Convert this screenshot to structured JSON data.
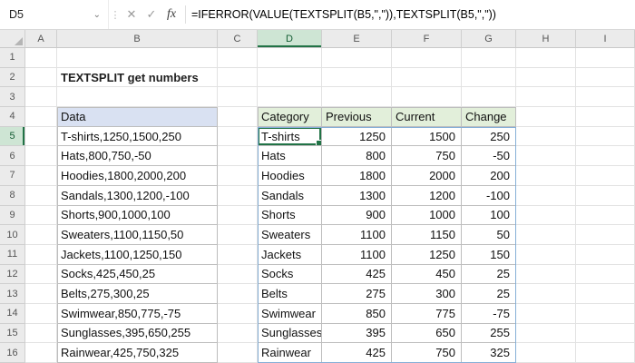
{
  "formula_bar": {
    "name_box": "D5",
    "formula": "=IFERROR(VALUE(TEXTSPLIT(B5,\",\")),TEXTSPLIT(B5,\",\"))"
  },
  "icons": {
    "chevron_down": "⌄",
    "resize_dots": "⋮",
    "cancel": "✕",
    "enter": "✓",
    "fx": "fx"
  },
  "col_headers": [
    "A",
    "B",
    "C",
    "D",
    "E",
    "F",
    "G",
    "H",
    "I"
  ],
  "row_headers": [
    "1",
    "2",
    "3",
    "4",
    "5",
    "6",
    "7",
    "8",
    "9",
    "10",
    "11",
    "12",
    "13",
    "14",
    "15",
    "16"
  ],
  "title": "TEXTSPLIT get numbers",
  "data_block": {
    "header": "Data",
    "items": [
      "T-shirts,1250,1500,250",
      "Hats,800,750,-50",
      "Hoodies,1800,2000,200",
      "Sandals,1300,1200,-100",
      "Shorts,900,1000,100",
      "Sweaters,1100,1150,50",
      "Jackets,1100,1250,150",
      "Socks,425,450,25",
      "Belts,275,300,25",
      "Swimwear,850,775,-75",
      "Sunglasses,395,650,255",
      "Rainwear,425,750,325"
    ]
  },
  "result_table": {
    "headers": [
      "Category",
      "Previous",
      "Current",
      "Change"
    ],
    "rows": [
      [
        "T-shirts",
        "1250",
        "1500",
        "250"
      ],
      [
        "Hats",
        "800",
        "750",
        "-50"
      ],
      [
        "Hoodies",
        "1800",
        "2000",
        "200"
      ],
      [
        "Sandals",
        "1300",
        "1200",
        "-100"
      ],
      [
        "Shorts",
        "900",
        "1000",
        "100"
      ],
      [
        "Sweaters",
        "1100",
        "1150",
        "50"
      ],
      [
        "Jackets",
        "1100",
        "1250",
        "150"
      ],
      [
        "Socks",
        "425",
        "450",
        "25"
      ],
      [
        "Belts",
        "275",
        "300",
        "25"
      ],
      [
        "Swimwear",
        "850",
        "775",
        "-75"
      ],
      [
        "Sunglasses",
        "395",
        "650",
        "255"
      ],
      [
        "Rainwear",
        "425",
        "750",
        "325"
      ]
    ]
  },
  "selection": {
    "active_cell": "D5",
    "spill_range": "D5:G16"
  },
  "colors": {
    "selection_green": "#217346",
    "table_header_fill": "#E2EFDA",
    "data_header_fill": "#D9E1F2",
    "header_highlight": "#CEE5D4",
    "spill_border": "#86AFD7"
  }
}
